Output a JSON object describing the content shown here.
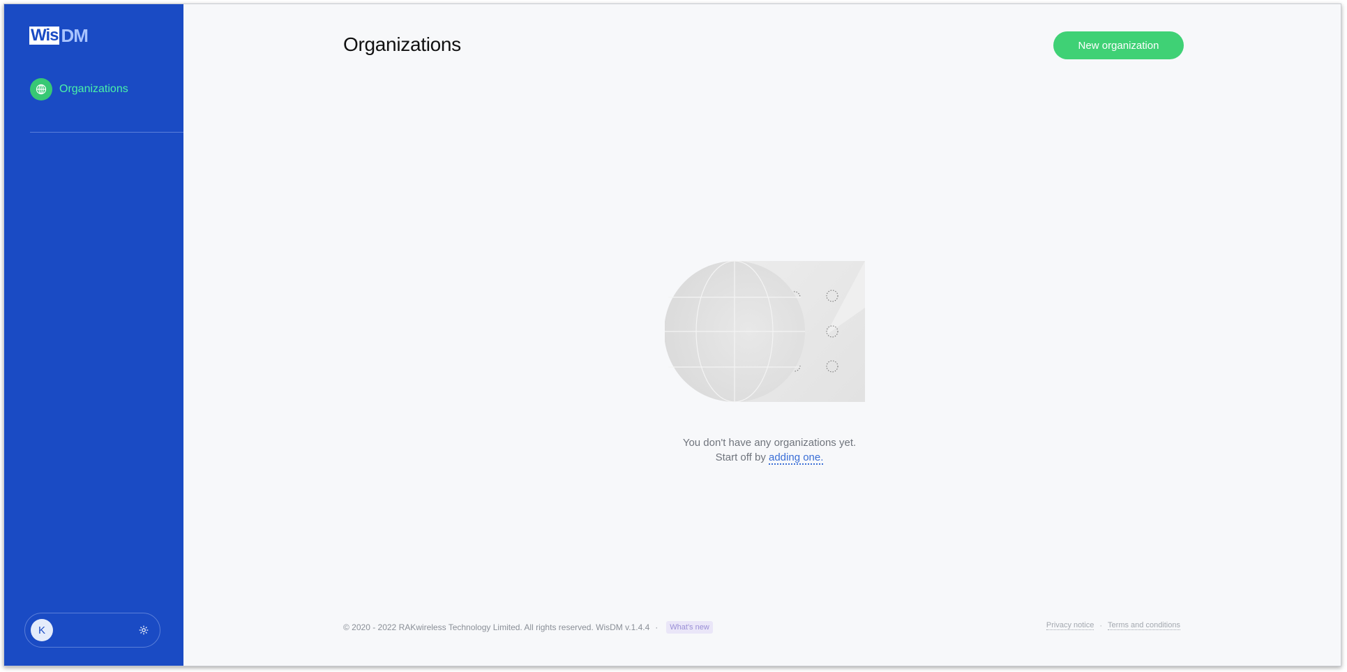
{
  "brand": {
    "logo_part1": "Wis",
    "logo_part2": "DM"
  },
  "sidebar": {
    "items": [
      {
        "label": "Organizations",
        "icon": "globe-icon"
      }
    ],
    "user": {
      "initial": "K",
      "settings_icon": "gear-icon"
    }
  },
  "header": {
    "title": "Organizations",
    "new_button_label": "New organization"
  },
  "empty_state": {
    "line1": "You don't have any organizations yet.",
    "line2_prefix": "Start off by ",
    "link_label": "adding one",
    "line2_suffix": "."
  },
  "footer": {
    "copyright": "© 2020 - 2022 RAKwireless Technology Limited. All rights reserved. WisDM v.1.4.4",
    "separator": "·",
    "whats_new": "What's new",
    "privacy": "Privacy notice",
    "terms": "Terms and conditions"
  },
  "colors": {
    "sidebar": "#1a4bc4",
    "accent": "#3fd175",
    "nav_active_text": "#4af2a8",
    "link": "#3a6ed6"
  }
}
